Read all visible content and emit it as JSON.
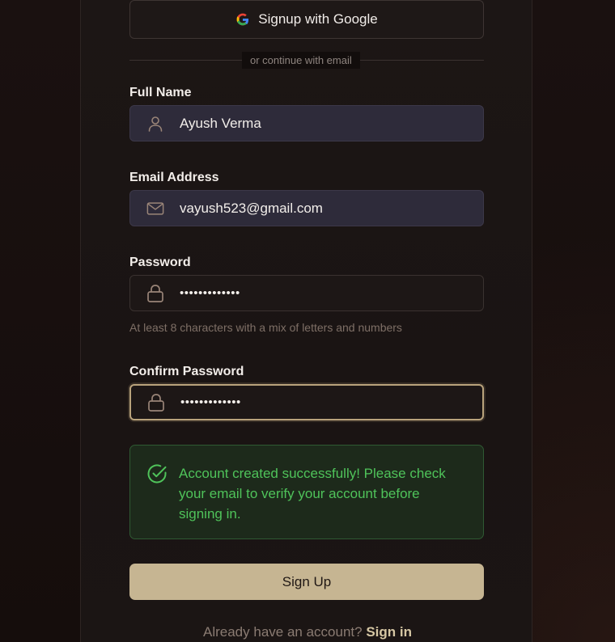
{
  "google_button": {
    "label": "Signup with Google",
    "icon": "google-icon"
  },
  "divider": {
    "text": "or continue with email"
  },
  "full_name": {
    "label": "Full Name",
    "value": "Ayush Verma",
    "icon": "user-icon"
  },
  "email": {
    "label": "Email Address",
    "value": "vayush523@gmail.com",
    "icon": "mail-icon"
  },
  "password": {
    "label": "Password",
    "value": "•••••••••••••",
    "icon": "lock-icon",
    "hint": "At least 8 characters with a mix of letters and numbers"
  },
  "confirm_password": {
    "label": "Confirm Password",
    "value": "•••••••••••••",
    "icon": "lock-icon"
  },
  "alert": {
    "icon": "check-circle-icon",
    "message": "Account created successfully! Please check your email to verify your account before signing in."
  },
  "signup_button": {
    "label": "Sign Up"
  },
  "footer": {
    "prompt": "Already have an account?",
    "link": "Sign in"
  },
  "colors": {
    "accent": "#c6b592",
    "success": "#4fc35a",
    "background": "#160e0d"
  }
}
